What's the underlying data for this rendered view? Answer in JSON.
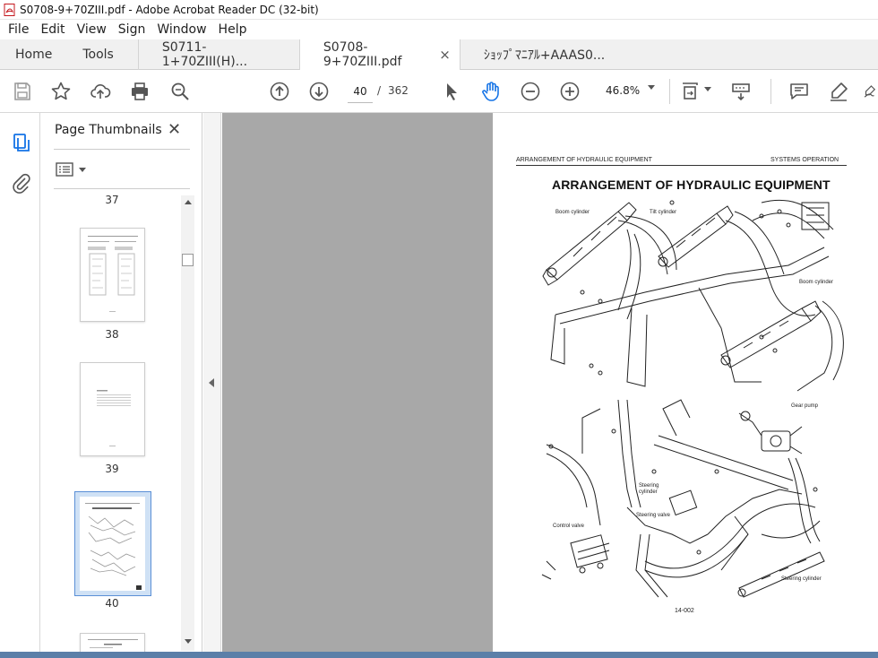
{
  "window": {
    "title": "S0708-9+70ZIII.pdf - Adobe Acrobat Reader DC (32-bit)"
  },
  "menubar": {
    "items": [
      "File",
      "Edit",
      "View",
      "Sign",
      "Window",
      "Help"
    ]
  },
  "tabs": {
    "home": "Home",
    "tools": "Tools",
    "documents": [
      {
        "label": "S0711-1+70ZIII(H)...",
        "active": false
      },
      {
        "label": "S0708-9+70ZIII.pdf",
        "active": true,
        "close": "×"
      },
      {
        "label": "ｼｮｯﾌﾟﾏﾆｱﾙ+AAAS0...",
        "active": false
      }
    ]
  },
  "toolbar": {
    "icons": [
      "save-icon",
      "bookmark-star-icon",
      "upload-icon",
      "print-icon",
      "zoom-search-icon",
      "prev-page-icon",
      "next-page-icon",
      "select-arrow-icon",
      "hand-tool-icon",
      "zoom-out-icon",
      "zoom-in-icon",
      "fit-page-icon",
      "scroll-mode-icon",
      "comment-icon",
      "highlight-pen-icon",
      "draw-icon"
    ],
    "current_page": "40",
    "page_separator": "/",
    "total_pages": "362",
    "zoom": "46.8%",
    "accent_color": "#1473e6"
  },
  "thumbnails_panel": {
    "title": "Page Thumbnails",
    "close": "✕",
    "pages": [
      {
        "label": "37"
      },
      {
        "label": "38"
      },
      {
        "label": "39"
      },
      {
        "label": "40",
        "selected": true
      }
    ]
  },
  "document_page": {
    "header_left": "ARRANGEMENT OF HYDRAULIC EQUIPMENT",
    "header_right": "SYSTEMS OPERATION",
    "title": "ARRANGEMENT OF HYDRAULIC EQUIPMENT",
    "callouts": {
      "boom_cylinder_1": "Boom cylinder",
      "tilt_cylinder": "Tilt cylinder",
      "boom_cylinder_2": "Boom cylinder",
      "gear_pump": "Gear pump",
      "steering_cylinder_top": "Steering\ncylinder",
      "steering_valve": "Steering valve",
      "control_valve": "Control valve",
      "steering_cylinder_bottom": "Steering cylinder"
    },
    "page_number": "14-002"
  }
}
